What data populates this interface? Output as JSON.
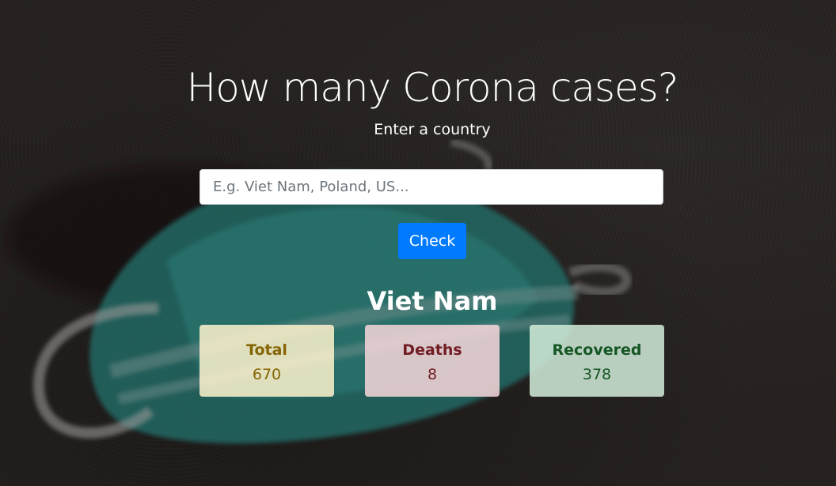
{
  "header": {
    "title": "How many Corona cases?",
    "subtitle": "Enter a country"
  },
  "search": {
    "placeholder": "E.g. Viet Nam, Poland, US...",
    "value": ""
  },
  "check_button": {
    "label": "Check",
    "color": "#007bff"
  },
  "result": {
    "country": "Viet Nam",
    "cards": [
      {
        "label": "Total",
        "value": "670",
        "color": "#856404",
        "background": "#fff3cd"
      },
      {
        "label": "Deaths",
        "value": "8",
        "color": "#721c24",
        "background": "#f8d7da"
      },
      {
        "label": "Recovered",
        "value": "378",
        "color": "#155724",
        "background": "#d4edda"
      }
    ]
  },
  "background": {
    "image": "face-mask-on-asphalt"
  }
}
